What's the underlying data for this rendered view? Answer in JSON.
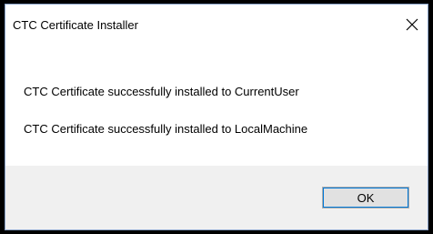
{
  "window": {
    "title": "CTC Certificate Installer",
    "close_icon": "close-icon"
  },
  "messages": [
    "CTC Certificate successfully installed to CurrentUser",
    "CTC Certificate successfully installed to LocalMachine"
  ],
  "buttons": {
    "ok_label": "OK"
  },
  "colors": {
    "screen_background": "#000000",
    "dialog_background": "#ffffff",
    "footer_background": "#f0f0f0",
    "button_background": "#e1e1e1",
    "focus_accent": "#0078d7"
  }
}
